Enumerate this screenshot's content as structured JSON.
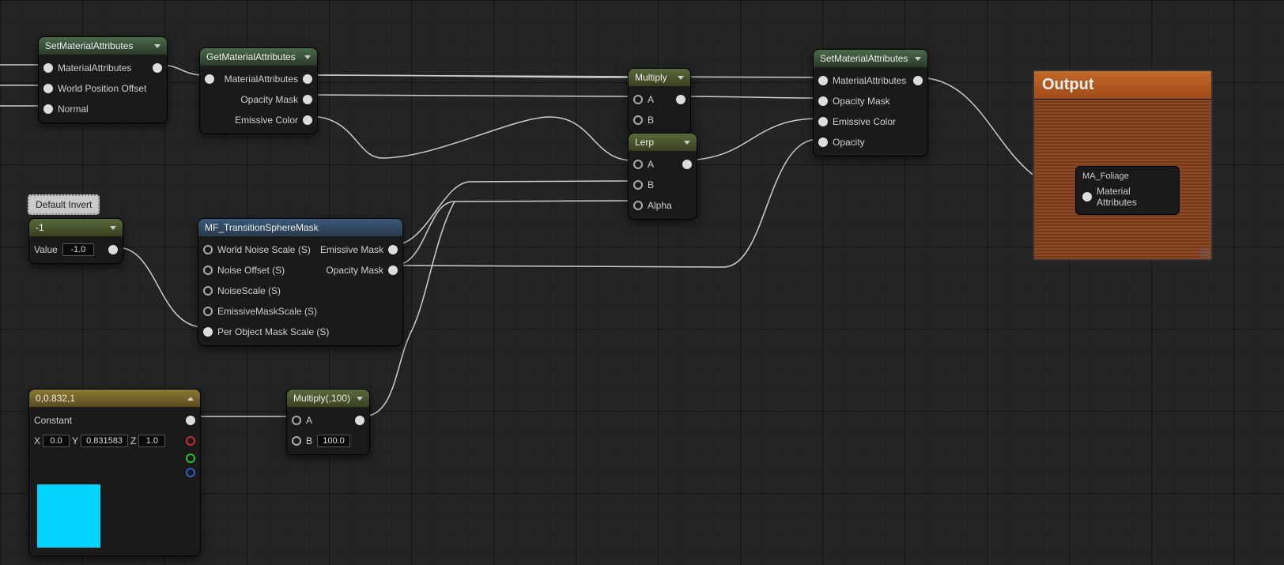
{
  "nodes": {
    "setMatAttr1": {
      "title": "SetMaterialAttributes",
      "inputs": [
        "MaterialAttributes",
        "World Position Offset",
        "Normal"
      ]
    },
    "getMatAttr": {
      "title": "GetMaterialAttributes",
      "inputs": [
        "MaterialAttributes"
      ],
      "outputs_extra": [
        "Opacity Mask",
        "Emissive Color"
      ]
    },
    "multiply": {
      "title": "Multiply",
      "a": "A",
      "b": "B"
    },
    "lerp": {
      "title": "Lerp",
      "a": "A",
      "b": "B",
      "alpha": "Alpha"
    },
    "setMatAttr2": {
      "title": "SetMaterialAttributes",
      "inputs": [
        "MaterialAttributes",
        "Opacity Mask",
        "Emissive Color",
        "Opacity"
      ]
    },
    "paramNeg1": {
      "title": "-1",
      "value_label": "Value",
      "value": "-1.0"
    },
    "paramTooltip": "Default Invert",
    "mfTransition": {
      "title": "MF_TransitionSphereMask",
      "inputs": [
        "World Noise Scale (S)",
        "Noise Offset (S)",
        "NoiseScale (S)",
        "EmissiveMaskScale (S)",
        "Per Object Mask Scale (S)"
      ],
      "outputs": [
        "Emissive Mask",
        "Opacity Mask"
      ]
    },
    "constVec": {
      "title": "0,0.832,1",
      "const_label": "Constant",
      "x_label": "X",
      "x": "0.0",
      "y_label": "Y",
      "y": "0.831583",
      "z_label": "Z",
      "z": "1.0",
      "swatch_color": "#00d4ff"
    },
    "multiply100": {
      "title": "Multiply(,100)",
      "a": "A",
      "b_label": "B",
      "b_value": "100.0"
    },
    "output": {
      "title": "Output",
      "inner_title": "MA_Foliage",
      "pin_label": "Material Attributes"
    }
  }
}
